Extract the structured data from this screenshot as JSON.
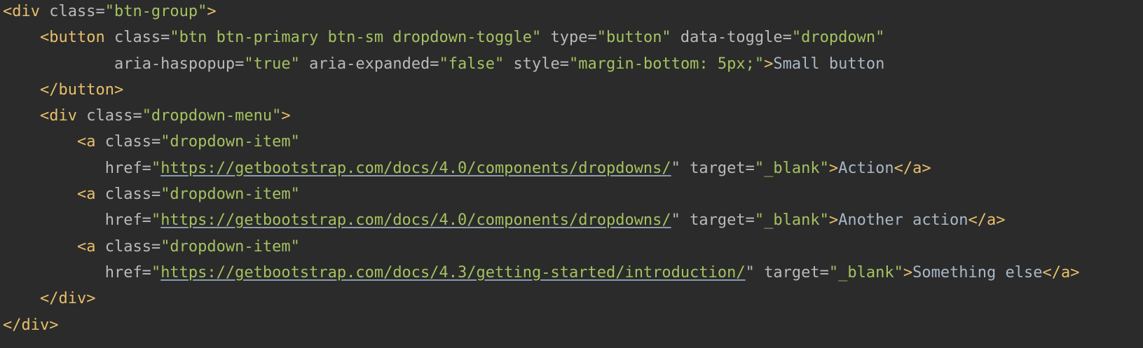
{
  "editor": {
    "colors": {
      "background": "#2b2b2b",
      "tag": "#e8bf6a",
      "attribute": "#bababa",
      "string": "#a5c261",
      "text": "#a9b7c6"
    },
    "lines": [
      {
        "indent": 0,
        "tokens": [
          [
            "tag",
            "<div"
          ],
          [
            "attr",
            " class="
          ],
          [
            "str",
            "\"btn-group\""
          ],
          [
            "tag",
            ">"
          ]
        ]
      },
      {
        "indent": 4,
        "tokens": [
          [
            "tag",
            "<button"
          ],
          [
            "attr",
            " class="
          ],
          [
            "str",
            "\"btn btn-primary btn-sm dropdown-toggle\""
          ],
          [
            "attr",
            " type="
          ],
          [
            "str",
            "\"button\""
          ],
          [
            "attr",
            " data-toggle="
          ],
          [
            "str",
            "\"dropdown\""
          ]
        ]
      },
      {
        "indent": 12,
        "tokens": [
          [
            "attr",
            "aria-haspopup="
          ],
          [
            "str",
            "\"true\""
          ],
          [
            "attr",
            " aria-expanded="
          ],
          [
            "str",
            "\"false\""
          ],
          [
            "attr",
            " style="
          ],
          [
            "str",
            "\"margin-bottom: 5px;\""
          ],
          [
            "tag",
            ">"
          ],
          [
            "text",
            "Small button"
          ]
        ]
      },
      {
        "indent": 4,
        "tokens": [
          [
            "tag",
            "</button>"
          ]
        ]
      },
      {
        "indent": 4,
        "tokens": [
          [
            "tag",
            "<div"
          ],
          [
            "attr",
            " class="
          ],
          [
            "str",
            "\"dropdown-menu\""
          ],
          [
            "tag",
            ">"
          ]
        ]
      },
      {
        "indent": 8,
        "tokens": [
          [
            "tag",
            "<a"
          ],
          [
            "attr",
            " class="
          ],
          [
            "str",
            "\"dropdown-item\""
          ]
        ]
      },
      {
        "indent": 11,
        "tokens": [
          [
            "attr",
            "href="
          ],
          [
            "str",
            "\""
          ],
          [
            "url",
            "https://getbootstrap.com/docs/4.0/components/dropdowns/"
          ],
          [
            "attr",
            "\""
          ],
          [
            "attr",
            " target="
          ],
          [
            "str",
            "\"_blank\""
          ],
          [
            "tag",
            ">"
          ],
          [
            "text",
            "Action"
          ],
          [
            "tag",
            "</a>"
          ]
        ]
      },
      {
        "indent": 8,
        "tokens": [
          [
            "tag",
            "<a"
          ],
          [
            "attr",
            " class="
          ],
          [
            "str",
            "\"dropdown-item\""
          ]
        ]
      },
      {
        "indent": 11,
        "tokens": [
          [
            "attr",
            "href="
          ],
          [
            "str",
            "\""
          ],
          [
            "url",
            "https://getbootstrap.com/docs/4.0/components/dropdowns/"
          ],
          [
            "attr",
            "\""
          ],
          [
            "attr",
            " target="
          ],
          [
            "str",
            "\"_blank\""
          ],
          [
            "tag",
            ">"
          ],
          [
            "text",
            "Another action"
          ],
          [
            "tag",
            "</a>"
          ]
        ]
      },
      {
        "indent": 8,
        "tokens": [
          [
            "tag",
            "<a"
          ],
          [
            "attr",
            " class="
          ],
          [
            "str",
            "\"dropdown-item\""
          ]
        ]
      },
      {
        "indent": 11,
        "tokens": [
          [
            "attr",
            "href="
          ],
          [
            "str",
            "\""
          ],
          [
            "url",
            "https://getbootstrap.com/docs/4.3/getting-started/introduction/"
          ],
          [
            "attr",
            "\""
          ],
          [
            "attr",
            " target="
          ],
          [
            "str",
            "\"_blank\""
          ],
          [
            "tag",
            ">"
          ],
          [
            "text",
            "Something else"
          ],
          [
            "tag",
            "</a>"
          ]
        ]
      },
      {
        "indent": 4,
        "tokens": [
          [
            "tag",
            "</div>"
          ]
        ]
      },
      {
        "indent": 0,
        "tokens": [
          [
            "tag",
            "</div>"
          ]
        ]
      }
    ]
  }
}
